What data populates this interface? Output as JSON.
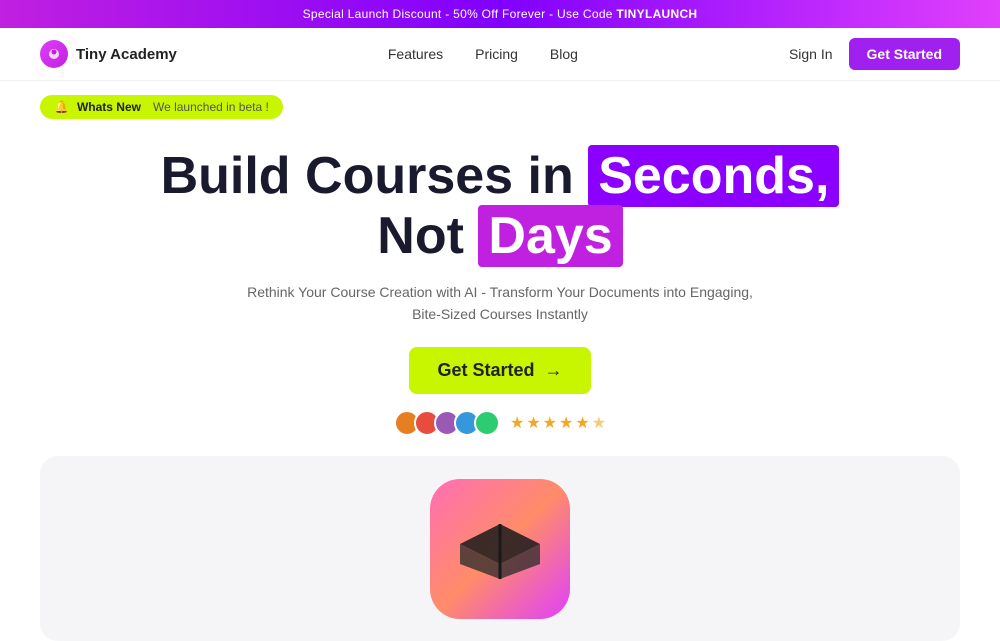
{
  "banner": {
    "text": "Special Launch Discount - 50% Off Forever - Use Code ",
    "code": "TINYLAUNCH"
  },
  "navbar": {
    "logo_text": "Tiny Academy",
    "links": [
      {
        "label": "Features",
        "id": "features"
      },
      {
        "label": "Pricing",
        "id": "pricing"
      },
      {
        "label": "Blog",
        "id": "blog"
      }
    ],
    "sign_in_label": "Sign In",
    "get_started_label": "Get Started"
  },
  "whats_new": {
    "badge_label": "Whats New",
    "description": "We launched in beta !"
  },
  "hero": {
    "title_part1": "Build Courses in ",
    "title_highlight1": "Seconds,",
    "title_part2": "Not ",
    "title_highlight2": "Days",
    "subtitle": "Rethink Your Course Creation with AI - Transform Your Documents into Engaging, Bite-Sized Courses Instantly",
    "cta_label": "Get Started",
    "cta_arrow": "→"
  },
  "social_proof": {
    "stars": [
      "★",
      "★",
      "★",
      "★",
      "★"
    ],
    "half_star": "½",
    "avatar_colors": [
      "#e67e22",
      "#e74c3c",
      "#9b59b6",
      "#3498db",
      "#2ecc71"
    ]
  },
  "colors": {
    "purple_highlight": "#8b00ff",
    "magenta_highlight": "#cc00cc",
    "cta_green": "#c8f500",
    "nav_purple": "#a020f0",
    "banner_gradient_start": "#c020e0",
    "banner_gradient_end": "#8000ff"
  }
}
